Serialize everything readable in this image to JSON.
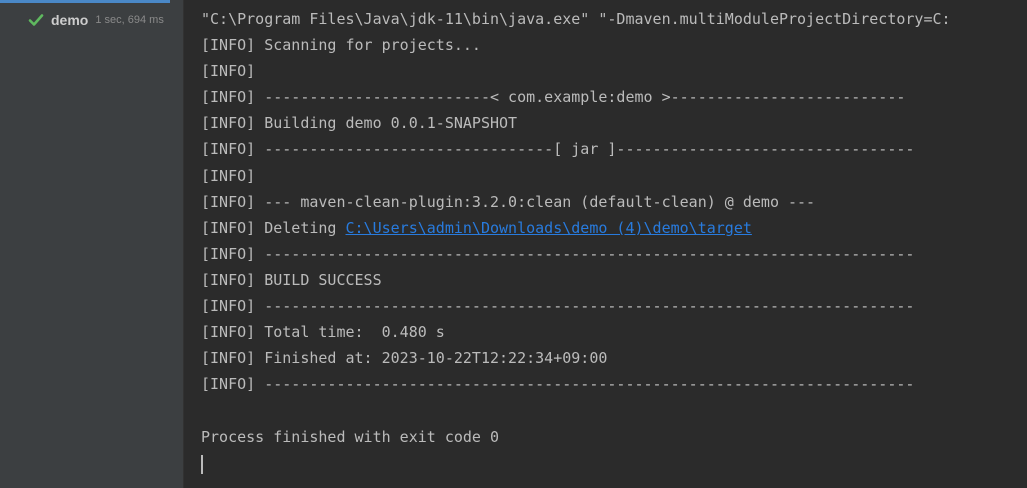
{
  "run_tree": {
    "item_label": "demo",
    "item_time": "1 sec, 694 ms",
    "status_icon": "check-icon",
    "status_color": "#5fb85f",
    "accent_color": "#4a88c7"
  },
  "console": {
    "command_line": "\"C:\\Program Files\\Java\\jdk-11\\bin\\java.exe\" \"-Dmaven.multiModuleProjectDirectory=C:",
    "lines": [
      "[INFO] Scanning for projects...",
      "[INFO]",
      "[INFO] -------------------------< com.example:demo >--------------------------",
      "[INFO] Building demo 0.0.1-SNAPSHOT",
      "[INFO] --------------------------------[ jar ]---------------------------------",
      "[INFO]",
      "[INFO] --- maven-clean-plugin:3.2.0:clean (default-clean) @ demo ---"
    ],
    "deleting_prefix": "[INFO] Deleting ",
    "deleting_path": "C:\\Users\\admin\\Downloads\\demo (4)\\demo\\target",
    "lines_after": [
      "[INFO] ------------------------------------------------------------------------",
      "[INFO] BUILD SUCCESS",
      "[INFO] ------------------------------------------------------------------------",
      "[INFO] Total time:  0.480 s",
      "[INFO] Finished at: 2023-10-22T12:22:34+09:00",
      "[INFO] ------------------------------------------------------------------------",
      ""
    ],
    "exit_message": "Process finished with exit code 0",
    "link_color": "#287bde",
    "text_color": "#bbbbbb",
    "background_color": "#2b2b2b"
  }
}
